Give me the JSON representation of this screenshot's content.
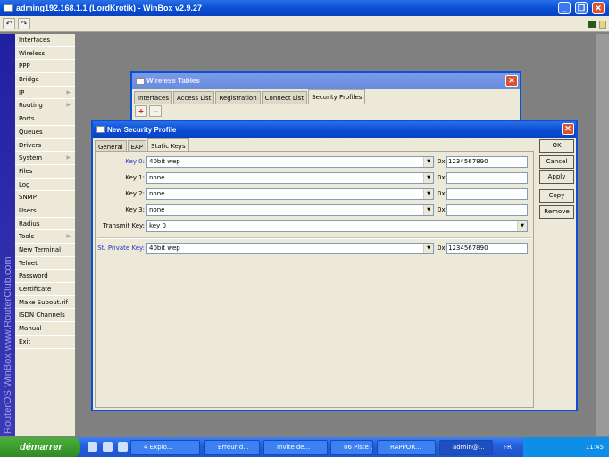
{
  "window": {
    "title": "adming192.168.1.1 (LordKrotik) - WinBox v2.9.27",
    "minimize": "_",
    "restore": "❐",
    "close": "✕"
  },
  "toolbar": {
    "undo": "↶",
    "redo": "↷"
  },
  "sidebar": {
    "brand": "RouterOS WinBox  www.RouterClub.com",
    "items": [
      {
        "label": "Interfaces"
      },
      {
        "label": "Wireless"
      },
      {
        "label": "PPP"
      },
      {
        "label": "Bridge"
      },
      {
        "label": "IP",
        "submenu": true
      },
      {
        "label": "Routing",
        "submenu": true
      },
      {
        "label": "Ports"
      },
      {
        "label": "Queues"
      },
      {
        "label": "Drivers"
      },
      {
        "label": "System",
        "submenu": true
      },
      {
        "label": "Files"
      },
      {
        "label": "Log"
      },
      {
        "label": "SNMP"
      },
      {
        "label": "Users"
      },
      {
        "label": "Radius"
      },
      {
        "label": "Tools",
        "submenu": true
      },
      {
        "label": "New Terminal"
      },
      {
        "label": "Telnet"
      },
      {
        "label": "Password"
      },
      {
        "label": "Certificate"
      },
      {
        "label": "Make Supout.rif"
      },
      {
        "label": "ISDN Channels"
      },
      {
        "label": "Manual"
      },
      {
        "label": "Exit"
      }
    ]
  },
  "wireless_tables": {
    "title": "Wireless Tables",
    "tabs": [
      "Interfaces",
      "Access List",
      "Registration",
      "Connect List",
      "Security Profiles"
    ],
    "active_tab": "Security Profiles",
    "add": "+",
    "remove": "−"
  },
  "dialog": {
    "title": "New Security Profile",
    "tabs": [
      "General",
      "EAP",
      "Static Keys"
    ],
    "active_tab": "Static Keys",
    "keys": [
      {
        "label": "Key 0:",
        "type": "40bit wep",
        "prefix": "0x",
        "value": "1234567890"
      },
      {
        "label": "Key 1:",
        "type": "none",
        "prefix": "0x",
        "value": ""
      },
      {
        "label": "Key 2:",
        "type": "none",
        "prefix": "0x",
        "value": ""
      },
      {
        "label": "Key 3:",
        "type": "none",
        "prefix": "0x",
        "value": ""
      }
    ],
    "transmit": {
      "label": "Transmit Key:",
      "value": "key 0"
    },
    "private": {
      "label": "St. Private Key:",
      "type": "40bit wep",
      "prefix": "0x",
      "value": "1234567890"
    },
    "buttons": {
      "ok": "OK",
      "cancel": "Cancel",
      "apply": "Apply",
      "copy": "Copy",
      "remove": "Remove"
    }
  },
  "taskbar": {
    "start": "démarrer",
    "tasks": [
      "4 Explo...",
      "Erreur d...",
      "Invite de...",
      "06 Piste ...",
      "RAPPOR...",
      "admin@..."
    ],
    "lang": "FR",
    "clock": "11:45"
  }
}
